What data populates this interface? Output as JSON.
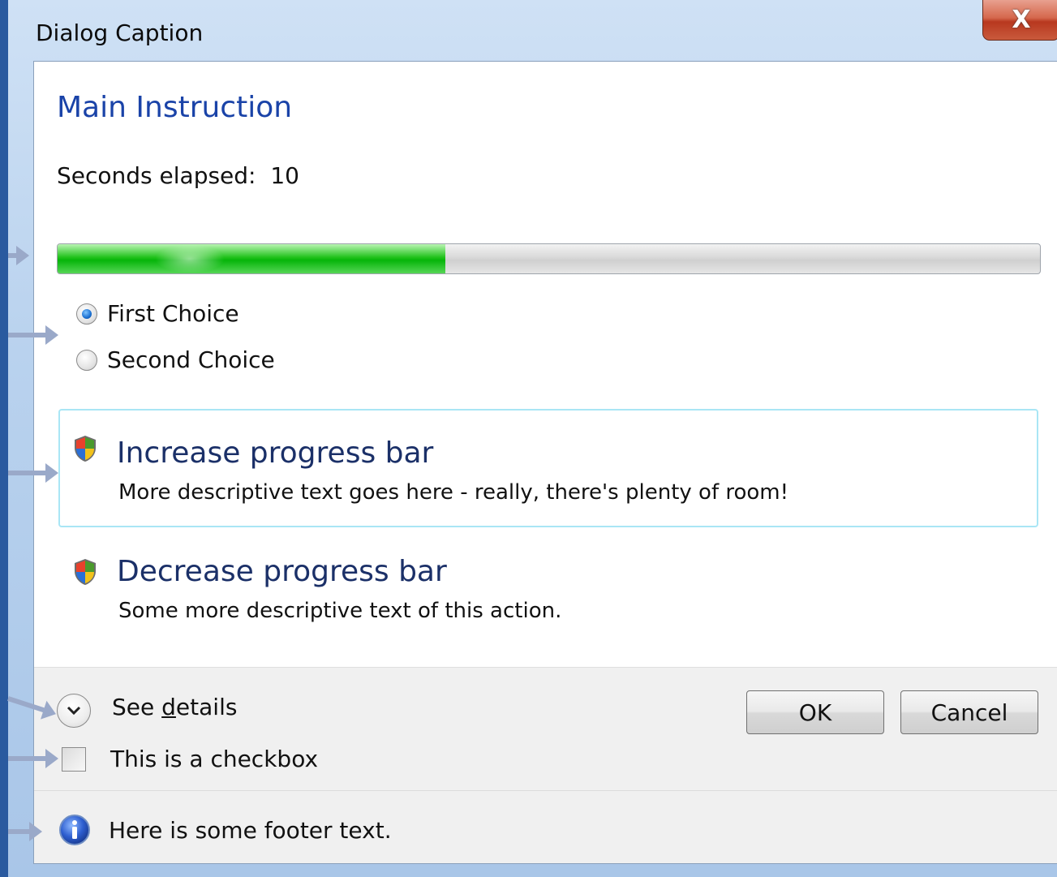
{
  "window": {
    "caption": "Dialog Caption",
    "close_glyph": "X",
    "close_icon": "close-icon"
  },
  "main_instruction": "Main Instruction",
  "content": {
    "label": "Seconds elapsed:",
    "value": "10"
  },
  "progress": {
    "fraction": 0.395,
    "fill_color": "#0bb80e"
  },
  "radios": [
    {
      "label": "First Choice",
      "checked": true
    },
    {
      "label": "Second Choice",
      "checked": false
    }
  ],
  "command_links": [
    {
      "title": "Increase progress bar",
      "description": "More descriptive text goes here - really, there's plenty of room!",
      "icon": "shield-icon"
    },
    {
      "title": "Decrease progress bar",
      "description": "Some more descriptive text of this action.",
      "icon": "shield-icon"
    }
  ],
  "expando": {
    "label_prefix": "See ",
    "label_underlined": "d",
    "label_suffix": "etails",
    "icon": "chevron-down-icon"
  },
  "buttons": {
    "ok": "OK",
    "cancel": "Cancel"
  },
  "checkbox": {
    "label": "This is a checkbox",
    "checked": false
  },
  "footer": {
    "text": "Here is some footer text.",
    "icon": "info-icon"
  },
  "colors": {
    "main_instruction": "#1a43a8",
    "command_link_title": "#1b3068",
    "hover_border": "#a9e6f5"
  }
}
